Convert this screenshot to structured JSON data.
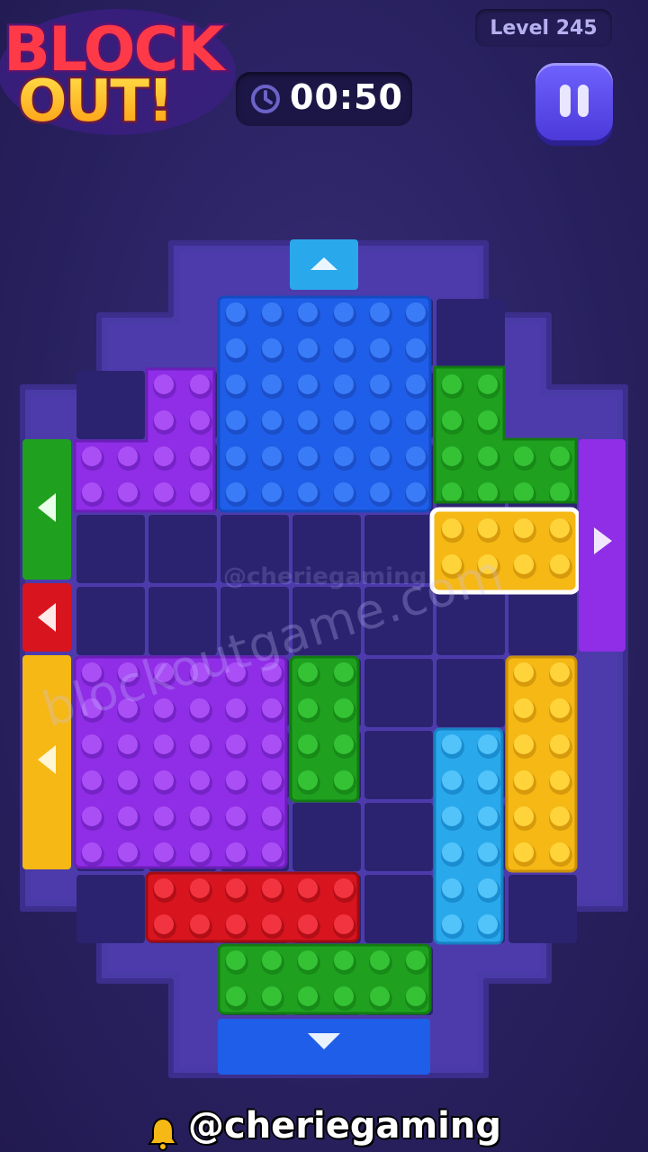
{
  "app": {
    "logo_line1": "BLOCK",
    "logo_line2": "OUT!",
    "level_label": "Level 245",
    "timer": "00:50",
    "pause_icon": "pause-icon",
    "timer_icon": "clock-icon"
  },
  "watermarks": {
    "main": "blockoutgame.com",
    "small": "@cheriegaming"
  },
  "credit": {
    "handle": "@cheriegaming",
    "icon": "bell-icon"
  },
  "colors": {
    "blue": "#1f5ee8",
    "purple": "#8f2ee6",
    "green": "#1fa11f",
    "yellow": "#f5b814",
    "red": "#d8141e",
    "cyan": "#2aa8ec",
    "board": "#4a3aa8",
    "cell": "#2b2370"
  },
  "blocks": [
    {
      "id": "blue-big",
      "color": "blue",
      "studs": "6x6"
    },
    {
      "id": "purple-top-l",
      "color": "purple",
      "shape": "L"
    },
    {
      "id": "green-top-l",
      "color": "green",
      "shape": "L"
    },
    {
      "id": "yellow-selected",
      "color": "yellow",
      "studs": "4x2",
      "selected": true
    },
    {
      "id": "purple-big",
      "color": "purple",
      "studs": "6x6"
    },
    {
      "id": "green-small",
      "color": "green",
      "studs": "2x4"
    },
    {
      "id": "yellow-tall",
      "color": "yellow",
      "studs": "2x6"
    },
    {
      "id": "cyan-tall",
      "color": "cyan",
      "studs": "2x6"
    },
    {
      "id": "red-long",
      "color": "red",
      "studs": "6x2"
    },
    {
      "id": "green-bottom",
      "color": "green",
      "studs": "6x2"
    }
  ],
  "exits": [
    {
      "id": "exit-top",
      "color": "cyan",
      "direction": "up"
    },
    {
      "id": "exit-bottom",
      "color": "blue",
      "direction": "down"
    },
    {
      "id": "exit-right",
      "color": "purple",
      "direction": "right"
    },
    {
      "id": "exit-left-green",
      "color": "green",
      "direction": "left"
    },
    {
      "id": "exit-left-red",
      "color": "red",
      "direction": "left"
    },
    {
      "id": "exit-left-yellow",
      "color": "yellow",
      "direction": "left"
    }
  ]
}
